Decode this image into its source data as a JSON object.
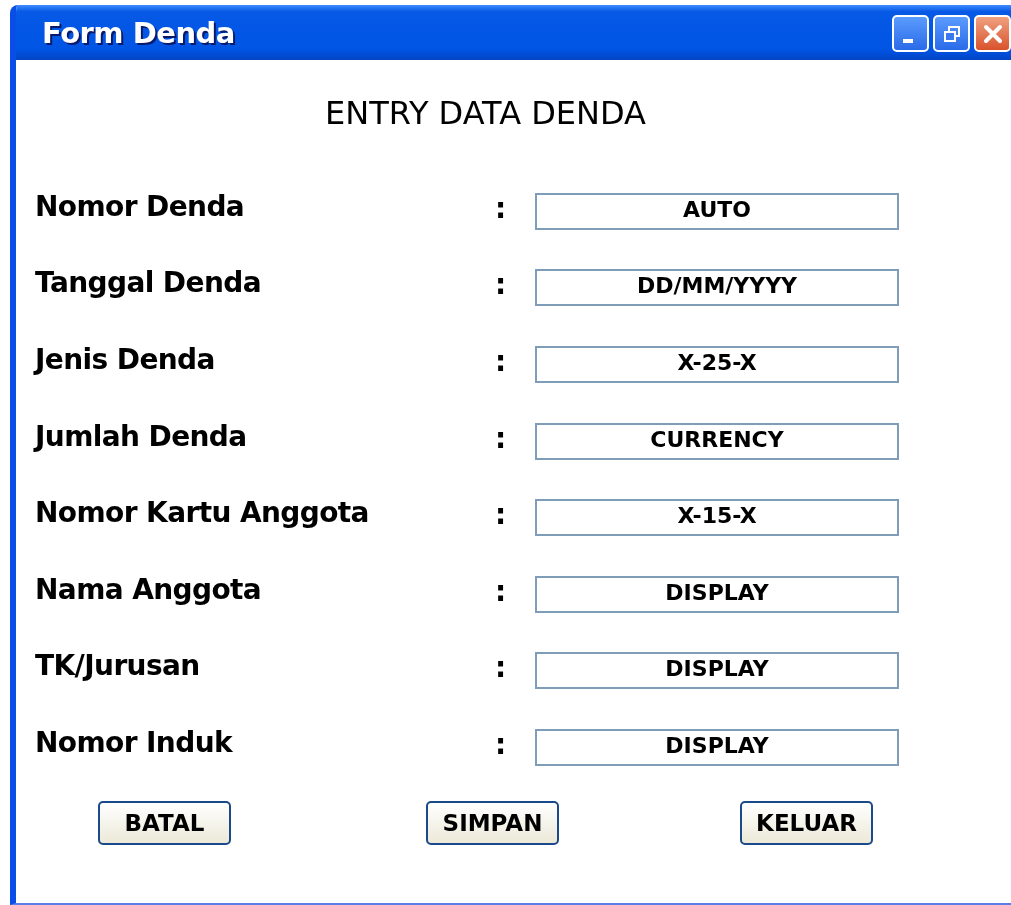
{
  "window": {
    "title": "Form Denda"
  },
  "heading": "ENTRY DATA DENDA",
  "fields": [
    {
      "label": "Nomor Denda",
      "separator": ":",
      "value": "AUTO"
    },
    {
      "label": "Tanggal Denda",
      "separator": ":",
      "value": "DD/MM/YYYY"
    },
    {
      "label": "Jenis Denda",
      "separator": ":",
      "value": "X-25-X"
    },
    {
      "label": "Jumlah Denda",
      "separator": ":",
      "value": "CURRENCY"
    },
    {
      "label": "Nomor Kartu Anggota",
      "separator": ":",
      "value": "X-15-X"
    },
    {
      "label": "Nama Anggota",
      "separator": ":",
      "value": "DISPLAY"
    },
    {
      "label": "TK/Jurusan",
      "separator": ":",
      "value": "DISPLAY"
    },
    {
      "label": "Nomor Induk",
      "separator": ":",
      "value": "DISPLAY"
    }
  ],
  "buttons": [
    "BATAL",
    "SIMPAN",
    "KELUAR"
  ]
}
